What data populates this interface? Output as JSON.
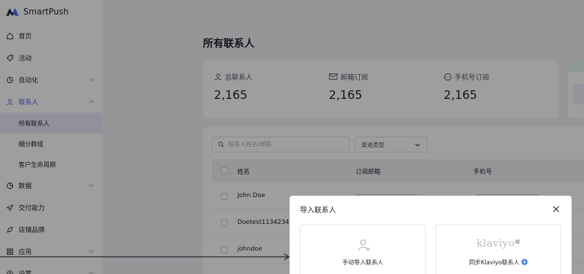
{
  "app": {
    "name": "SmartPush"
  },
  "sidebar": {
    "items": [
      {
        "label": "首页",
        "icon": "home-icon"
      },
      {
        "label": "活动",
        "icon": "tag-icon"
      },
      {
        "label": "自动化",
        "icon": "automation-icon",
        "expandable": true
      },
      {
        "label": "联系人",
        "icon": "user-icon",
        "expandable": true,
        "expanded": true
      },
      {
        "label": "数据",
        "icon": "chart-icon",
        "expandable": true
      },
      {
        "label": "交付能力",
        "icon": "send-icon"
      },
      {
        "label": "店铺品牌",
        "icon": "brand-icon"
      },
      {
        "label": "应用",
        "icon": "apps-icon",
        "expandable": true
      },
      {
        "label": "设置",
        "icon": "settings-icon",
        "expandable": true
      }
    ],
    "contacts_sub": [
      {
        "label": "所有联系人",
        "active": true
      },
      {
        "label": "细分群组"
      },
      {
        "label": "客户生命周期"
      }
    ]
  },
  "main": {
    "title": "所有联系人",
    "stats": [
      {
        "label": "总联系人",
        "value": "2,165",
        "icon": "person-icon"
      },
      {
        "label": "邮箱订阅",
        "value": "2,165",
        "icon": "mail-icon"
      },
      {
        "label": "手机号订阅",
        "value": "2,165",
        "icon": "chat-icon"
      }
    ],
    "search": {
      "placeholder": "联系人姓名/邮箱"
    },
    "channel_select": {
      "value": "渠道类型"
    },
    "table": {
      "columns": [
        "姓名",
        "订阅邮箱",
        "手机号"
      ],
      "rows": [
        {
          "name": "John Doe"
        },
        {
          "name": "Doetest11342342"
        },
        {
          "name": "johndoe"
        }
      ]
    }
  },
  "modal": {
    "title": "导入联系人",
    "options": [
      {
        "label": "手动导入联系人",
        "icon": "add-person-icon"
      },
      {
        "label": "同步Klaviyo联系人",
        "logo": "klaviyo"
      }
    ]
  },
  "colors": {
    "accent": "#5b5fe6",
    "overlay": "rgba(0,0,0,0.38)",
    "info": "#3b82f6"
  }
}
